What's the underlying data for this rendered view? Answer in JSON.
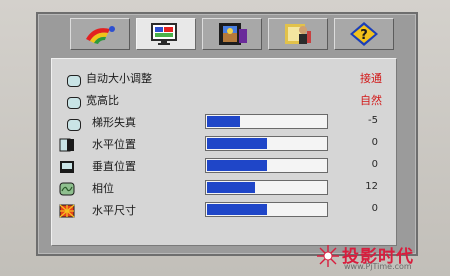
{
  "tabs": [
    {
      "name": "color-palette-icon",
      "active": false
    },
    {
      "name": "display-image-icon",
      "active": true
    },
    {
      "name": "film-setup-icon",
      "active": false
    },
    {
      "name": "person-options-icon",
      "active": false
    },
    {
      "name": "help-question-icon",
      "active": false
    }
  ],
  "colors": {
    "accent_blue": "#1f46c8",
    "value_red": "#d21818",
    "watermark_red": "#d81e3e"
  },
  "rows": [
    {
      "label": "自动大小调整",
      "value": "接通",
      "icon": "screen-auto-size-icon"
    },
    {
      "label": "宽高比",
      "value": "自然",
      "icon": "aspect-ratio-icon"
    },
    {
      "label": "梯形失真",
      "value": "-5",
      "level": 0.28,
      "icon": "keystone-icon"
    },
    {
      "label": "水平位置",
      "value": "0",
      "level": 0.5,
      "icon": "horizontal-position-icon"
    },
    {
      "label": "垂直位置",
      "value": "0",
      "level": 0.5,
      "icon": "vertical-position-icon"
    },
    {
      "label": "相位",
      "value": "12",
      "level": 0.4,
      "icon": "phase-icon"
    },
    {
      "label": "水平尺寸",
      "value": "0",
      "level": 0.5,
      "icon": "horizontal-size-icon"
    }
  ],
  "watermark": {
    "brand": "投影时代",
    "url": "www.PjTime.com"
  }
}
